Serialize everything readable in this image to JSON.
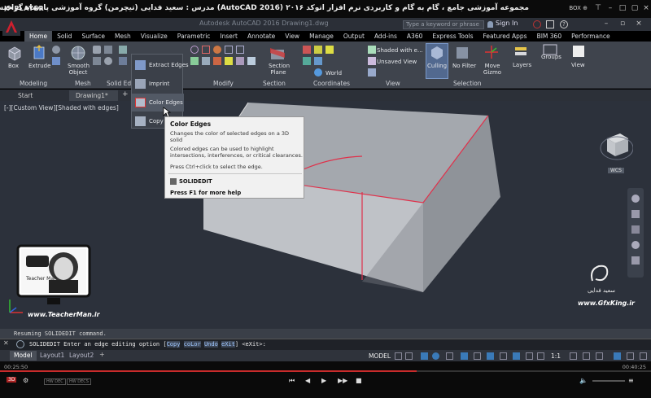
{
  "player": {
    "logo": "K•PLAYER",
    "title": "مجموعه آموزشی جامع ، گام به گام و کاربردی نرم افزار  اتوکد ۲۰۱۶ (AutoCAD 2016)  مدرس : سعید فدایی (تیچرمن) گروه آموزشی پادشاه گرافیست ها",
    "box_label": "BOX ⊕",
    "time_current": "00:25:50",
    "time_total": "00:40:25",
    "progress": 0.64,
    "hw_labels": [
      "HW DEC",
      "HW DECS"
    ]
  },
  "acad": {
    "app_name": "Autodesk AutoCAD 2016    Drawing1.dwg",
    "search_placeholder": "Type a keyword or phrase",
    "sign_in": "Sign In"
  },
  "ribbon_tabs": [
    "Home",
    "Solid",
    "Surface",
    "Mesh",
    "Visualize",
    "Parametric",
    "Insert",
    "Annotate",
    "View",
    "Manage",
    "Output",
    "Add-ins",
    "A360",
    "Express Tools",
    "Featured Apps",
    "BIM 360",
    "Performance"
  ],
  "ribbon": {
    "box": "Box",
    "extrude": "Extrude",
    "smooth_object": "Smooth Object",
    "section_plane": "Section Plane",
    "visual_style": "Shaded with e...",
    "saved_view": "Unsaved View",
    "world": "World",
    "culling": "Culling",
    "no_filter": "No Filter",
    "move_gizmo": "Move Gizmo",
    "layers": "Layers",
    "groups": "Groups",
    "view": "View",
    "panels": {
      "modeling": "Modeling",
      "mesh": "Mesh",
      "solid_editing": "Solid Edit",
      "modify": "Modify",
      "section": "Section",
      "coordinates": "Coordinates",
      "view": "View",
      "selection": "Selection"
    }
  },
  "dropdown": {
    "items": [
      "Extract Edges",
      "Imprint",
      "Color Edges",
      "Copy Edges"
    ]
  },
  "tooltip": {
    "title": "Color Edges",
    "desc": "Changes the color of selected edges on a 3D solid",
    "detail": "Colored edges can be used to highlight intersections, interferences, or critical clearances.",
    "hint": "Press Ctrl+click to select the edge.",
    "command": "SOLIDEDIT",
    "help": "Press F1 for more help"
  },
  "doc_tabs": [
    "Start",
    "Drawing1*"
  ],
  "viewport_label": "[-][Custom View][Shaded with edges]",
  "viewcube_label": "WCS",
  "watermarks": {
    "teacher_url": "www.TeacherMan.ir",
    "teacher_title": "Teacher Man",
    "gfx_url": "www.GfxKing.ir",
    "gfx_name": "سعید فدایی"
  },
  "command": {
    "history": "Resuming SOLIDEDIT command.",
    "prompt_prefix": "SOLIDEDIT Enter an edge editing option [",
    "options": [
      "Copy",
      "coLor",
      "Undo",
      "eXit"
    ],
    "prompt_suffix": "] <eXit>:"
  },
  "status": {
    "layout_tabs": [
      "Model",
      "Layout1",
      "Layout2"
    ],
    "model": "MODEL",
    "scale": "1:1"
  },
  "colors": {
    "viewport_bg": "#2c313b",
    "ribbon_bg": "#3f444d",
    "edge_highlight": "#e0304a",
    "progress": "#c82b2b"
  }
}
